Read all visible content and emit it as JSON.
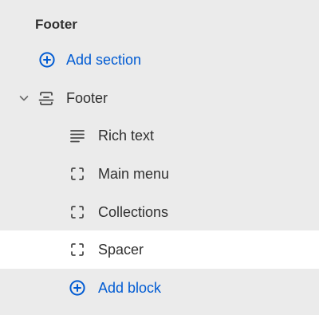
{
  "section_header": {
    "title": "Footer"
  },
  "add_section": {
    "label": "Add section",
    "icon": "plus-circle-icon"
  },
  "section": {
    "label": "Footer",
    "icon": "footer-section-icon",
    "expanded": true
  },
  "blocks": [
    {
      "label": "Rich text",
      "icon": "text-lines-icon",
      "selected": false
    },
    {
      "label": "Main menu",
      "icon": "block-frame-icon",
      "selected": false
    },
    {
      "label": "Collections",
      "icon": "block-frame-icon",
      "selected": false
    },
    {
      "label": "Spacer",
      "icon": "block-frame-icon",
      "selected": true
    }
  ],
  "add_block": {
    "label": "Add block",
    "icon": "plus-circle-icon"
  },
  "colors": {
    "panel_bg": "#ebebeb",
    "selected_bg": "#ffffff",
    "text": "#303030",
    "link": "#005bd3",
    "icon": "#4a4a4a"
  }
}
